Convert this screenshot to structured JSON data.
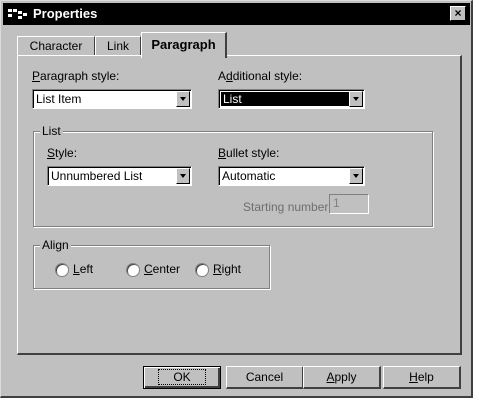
{
  "window": {
    "title": "Properties",
    "close_glyph": "×"
  },
  "tabs": [
    {
      "label": "Character",
      "active": false
    },
    {
      "label": "Link",
      "active": false
    },
    {
      "label": "Paragraph",
      "active": true
    }
  ],
  "paragraph_style": {
    "label_prefix": "",
    "label_accel": "P",
    "label_rest": "aragraph style:",
    "value": "List Item"
  },
  "additional_style": {
    "label_prefix": "A",
    "label_accel": "d",
    "label_rest": "ditional style:",
    "value": "List"
  },
  "list_group": {
    "title": "List",
    "style": {
      "label_accel": "S",
      "label_rest": "tyle:",
      "value": "Unnumbered List"
    },
    "bullet_style": {
      "label_accel": "B",
      "label_rest": "ullet style:",
      "value": "Automatic"
    },
    "starting_number": {
      "label": "Starting number:",
      "value": "1"
    }
  },
  "align_group": {
    "title": "Align",
    "options": [
      {
        "label_accel": "L",
        "label_rest": "eft"
      },
      {
        "label_accel": "C",
        "label_rest": "enter"
      },
      {
        "label_accel": "R",
        "label_rest": "ight"
      }
    ]
  },
  "buttons": {
    "ok": "OK",
    "cancel": "Cancel",
    "apply_accel": "A",
    "apply_rest": "pply",
    "help_accel": "H",
    "help_rest": "elp"
  },
  "icons": {
    "app": "app-logo-icon",
    "close": "close-icon",
    "dropdown": "chevron-down-icon"
  }
}
